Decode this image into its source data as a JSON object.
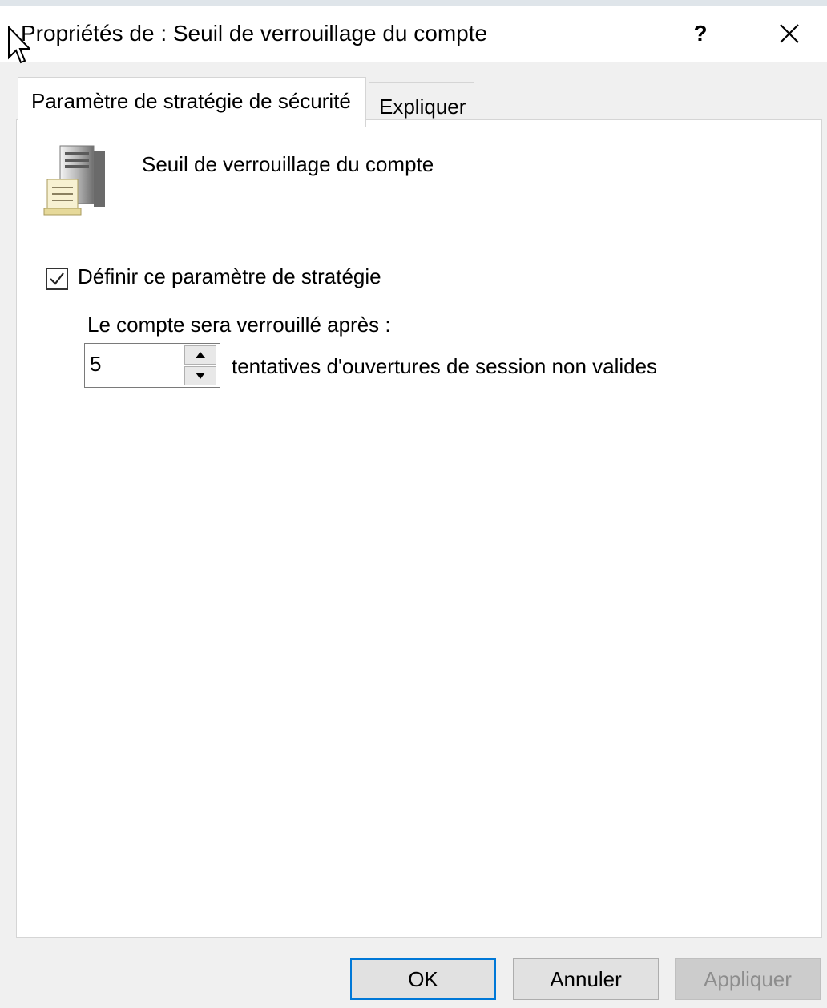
{
  "window": {
    "title": "Propriétés de : Seuil de verrouillage du compte",
    "help_label": "?",
    "close_icon": "close-icon"
  },
  "tabs": [
    {
      "label": "Paramètre de stratégie de sécurité",
      "active": true
    },
    {
      "label": "Expliquer",
      "active": false
    }
  ],
  "policy": {
    "icon": "server-document-icon",
    "name": "Seuil de verrouillage du compte",
    "define_checkbox": {
      "label": "Définir ce paramètre de stratégie",
      "checked": true
    },
    "lock_after_label": "Le compte sera verrouillé après :",
    "attempts_value": "5",
    "attempts_suffix": "tentatives d'ouvertures de session non valides"
  },
  "buttons": {
    "ok": "OK",
    "cancel": "Annuler",
    "apply": "Appliquer"
  },
  "colors": {
    "accent": "#0078d7",
    "window_bg": "#f0f0f0",
    "panel_bg": "#ffffff"
  }
}
